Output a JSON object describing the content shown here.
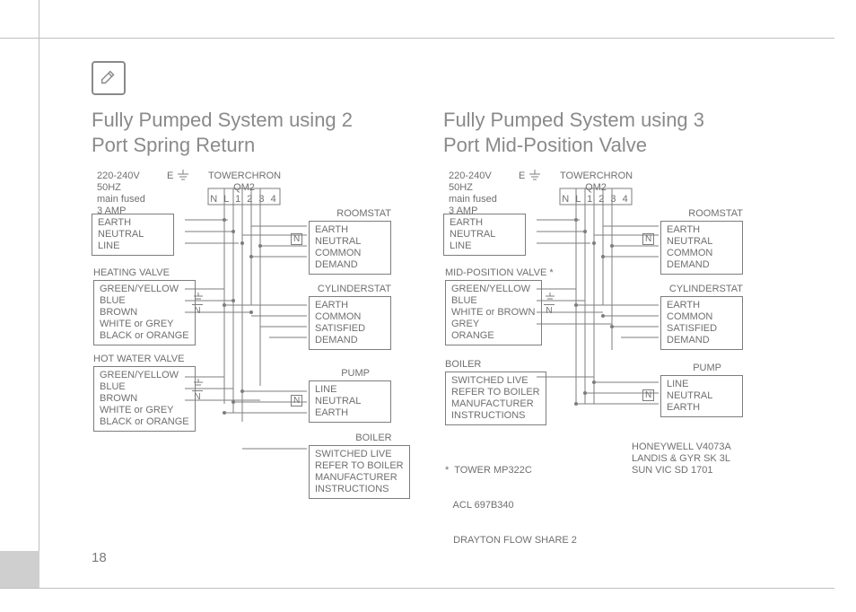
{
  "page_number": "18",
  "left": {
    "title": "Fully Pumped System using 2 Port Spring Return",
    "supply": {
      "l1": "220-240V",
      "l2": "50HZ",
      "l3": "main fused",
      "l4": "3 AMP"
    },
    "controller": {
      "name": "TOWERCHRON QM2",
      "terms": "N   L   1   2   3   4"
    },
    "mains": {
      "r1": "EARTH",
      "r2": "NEUTRAL",
      "r3": "LINE"
    },
    "heating": {
      "label": "HEATING VALVE",
      "r1": "GREEN/YELLOW",
      "r2": "BLUE",
      "r3": "BROWN",
      "r4": "WHITE or GREY",
      "r5": "BLACK or ORANGE"
    },
    "hot": {
      "label": "HOT WATER VALVE",
      "r1": "GREEN/YELLOW",
      "r2": "BLUE",
      "r3": "BROWN",
      "r4": "WHITE or GREY",
      "r5": "BLACK or ORANGE"
    },
    "roomstat": {
      "label": "ROOMSTAT",
      "r1": "EARTH",
      "r2": "NEUTRAL",
      "r3": "COMMON",
      "r4": "DEMAND"
    },
    "cylstat": {
      "label": "CYLINDERSTAT",
      "r1": "EARTH",
      "r2": "COMMON",
      "r3": "SATISFIED",
      "r4": "DEMAND"
    },
    "pump": {
      "label": "PUMP",
      "r1": "LINE",
      "r2": "NEUTRAL",
      "r3": "EARTH"
    },
    "boiler": {
      "label": "BOILER",
      "r1": "SWITCHED LIVE",
      "r2": "REFER TO BOILER",
      "r3": "MANUFACTURER",
      "r4": "INSTRUCTIONS"
    }
  },
  "right": {
    "title": "Fully Pumped System using 3 Port Mid-Position Valve",
    "supply": {
      "l1": "220-240V",
      "l2": "50HZ",
      "l3": "main fused",
      "l4": "3 AMP"
    },
    "controller": {
      "name": "TOWERCHRON QM2",
      "terms": "N   L   1   2   3   4"
    },
    "mains": {
      "r1": "EARTH",
      "r2": "NEUTRAL",
      "r3": "LINE"
    },
    "midpos": {
      "label": "MID-POSITION VALVE *",
      "r1": "GREEN/YELLOW",
      "r2": "BLUE",
      "r3": "WHITE or BROWN",
      "r4": "GREY",
      "r5": "ORANGE"
    },
    "boiler": {
      "label": "BOILER",
      "r1": "SWITCHED LIVE",
      "r2": "REFER TO BOILER",
      "r3": "MANUFACTURER",
      "r4": "INSTRUCTIONS"
    },
    "roomstat": {
      "label": "ROOMSTAT",
      "r1": "EARTH",
      "r2": "NEUTRAL",
      "r3": "COMMON",
      "r4": "DEMAND"
    },
    "cylstat": {
      "label": "CYLINDERSTAT",
      "r1": "EARTH",
      "r2": "COMMON",
      "r3": "SATISFIED",
      "r4": "DEMAND"
    },
    "pump": {
      "label": "PUMP",
      "r1": "LINE",
      "r2": "NEUTRAL",
      "r3": "EARTH"
    },
    "foot_left": {
      "l1": "*  TOWER MP322C",
      "l2": "   ACL 697B340",
      "l3": "   DRAYTON FLOW SHARE 2"
    },
    "foot_right": {
      "l1": "HONEYWELL V4073A",
      "l2": "LANDIS & GYR SK 3L",
      "l3": "SUN VIC SD 1701"
    }
  },
  "letters": {
    "E": "E",
    "N": "N"
  }
}
